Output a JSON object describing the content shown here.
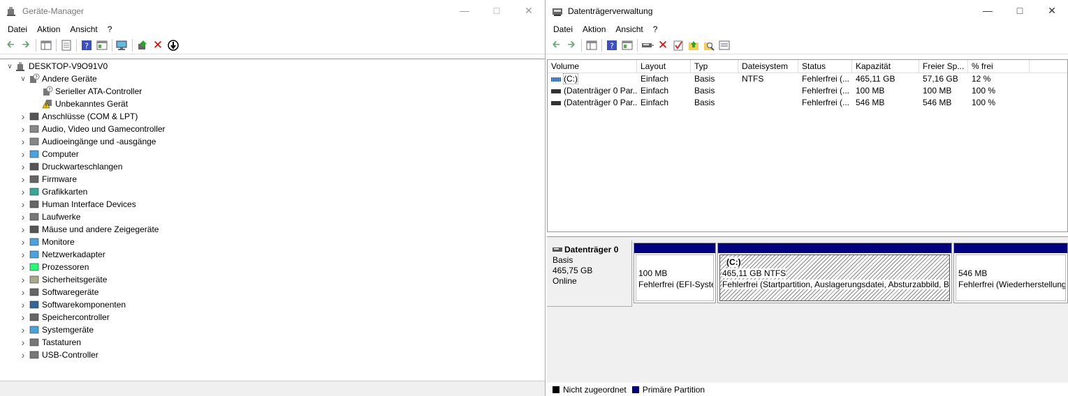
{
  "devmgr": {
    "title": "Geräte-Manager",
    "menu": [
      "Datei",
      "Aktion",
      "Ansicht",
      "?"
    ],
    "root": "DESKTOP-V9O91V0",
    "other_devices": {
      "label": "Andere Geräte",
      "children": [
        "Serieller ATA-Controller",
        "Unbekanntes Gerät"
      ]
    },
    "categories": [
      "Anschlüsse (COM & LPT)",
      "Audio, Video und Gamecontroller",
      "Audioeingänge und -ausgänge",
      "Computer",
      "Druckwarteschlangen",
      "Firmware",
      "Grafikkarten",
      "Human Interface Devices",
      "Laufwerke",
      "Mäuse und andere Zeigegeräte",
      "Monitore",
      "Netzwerkadapter",
      "Prozessoren",
      "Sicherheitsgeräte",
      "Softwaregeräte",
      "Softwarekomponenten",
      "Speichercontroller",
      "Systemgeräte",
      "Tastaturen",
      "USB-Controller"
    ]
  },
  "diskmgmt": {
    "title": "Datenträgerverwaltung",
    "menu": [
      "Datei",
      "Aktion",
      "Ansicht",
      "?"
    ],
    "columns": [
      "Volume",
      "Layout",
      "Typ",
      "Dateisystem",
      "Status",
      "Kapazität",
      "Freier Sp...",
      "% frei"
    ],
    "rows": [
      [
        "(C:)",
        "Einfach",
        "Basis",
        "NTFS",
        "Fehlerfrei (...",
        "465,11 GB",
        "57,16 GB",
        "12 %"
      ],
      [
        "(Datenträger 0 Par...",
        "Einfach",
        "Basis",
        "",
        "Fehlerfrei (...",
        "100 MB",
        "100 MB",
        "100 %"
      ],
      [
        "(Datenträger 0 Par...",
        "Einfach",
        "Basis",
        "",
        "Fehlerfrei (...",
        "546 MB",
        "546 MB",
        "100 %"
      ]
    ],
    "disk": {
      "name": "Datenträger 0",
      "type": "Basis",
      "size": "465,75 GB",
      "state": "Online"
    },
    "partitions": [
      {
        "title": "",
        "size": "100 MB",
        "status": "Fehlerfrei (EFI-Systempartition)"
      },
      {
        "title": "(C:)",
        "size": "465,11 GB NTFS",
        "status": "Fehlerfrei (Startpartition, Auslagerungsdatei, Absturzabbild, Basisdatenpartition)"
      },
      {
        "title": "",
        "size": "546 MB",
        "status": "Fehlerfrei (Wiederherstellungspartition)"
      }
    ],
    "legend": [
      "Nicht zugeordnet",
      "Primäre Partition"
    ],
    "colors": {
      "unallocated": "#000000",
      "primary": "#000080"
    }
  }
}
